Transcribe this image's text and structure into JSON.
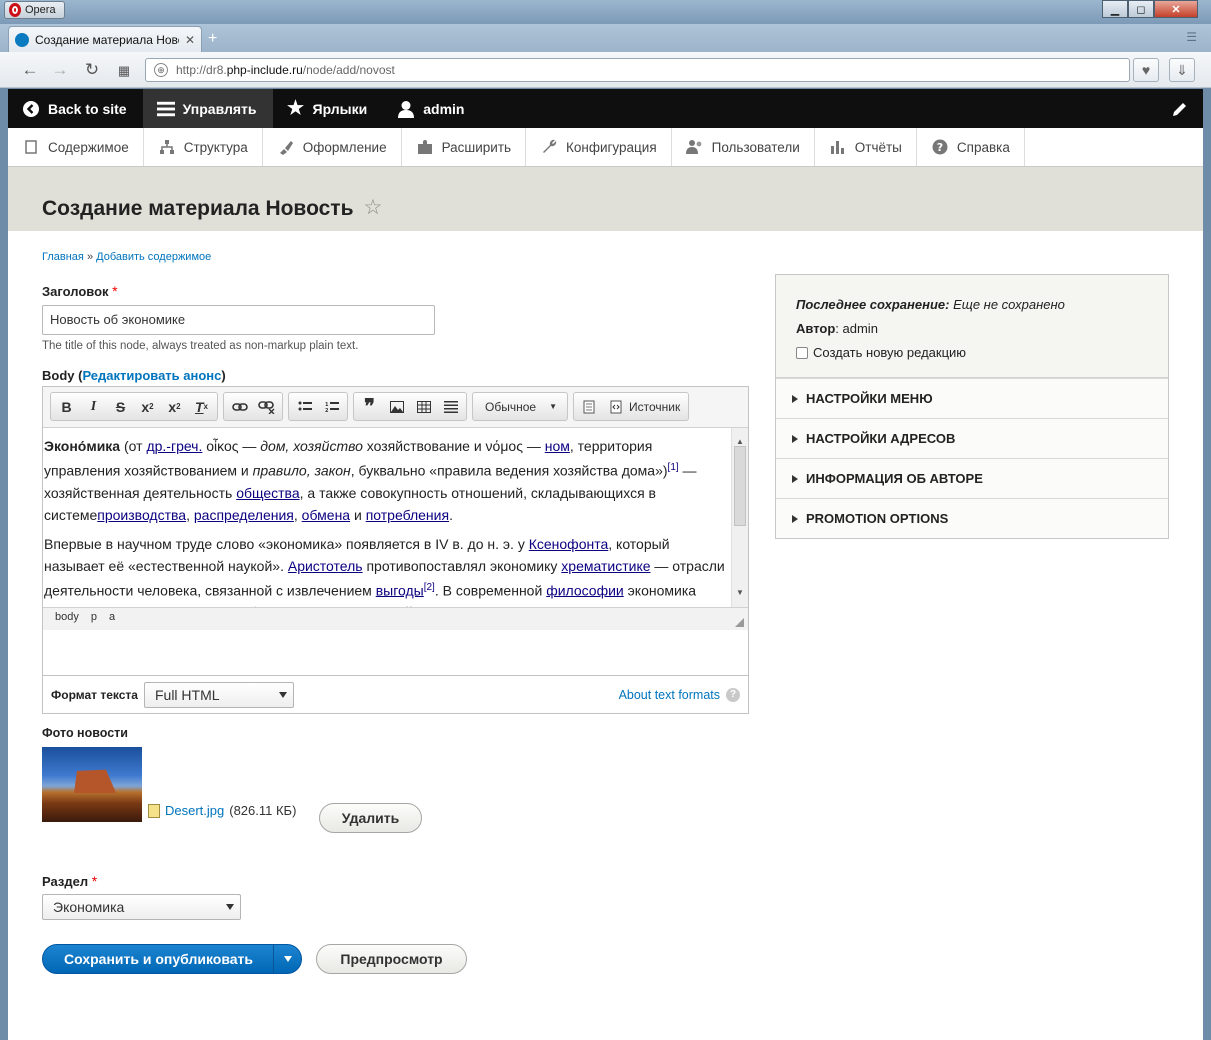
{
  "browser": {
    "app_name": "Opera",
    "tab_title": "Создание материала Новость",
    "url_prefix": "http://dr8.",
    "url_domain": "php-include.ru",
    "url_path": "/node/add/novost",
    "win_minimize": "▁",
    "win_restore": "◻",
    "win_close": "✕"
  },
  "toolbar": {
    "back": "Back to site",
    "manage": "Управлять",
    "shortcuts": "Ярлыки",
    "user": "admin"
  },
  "tray": {
    "items": [
      "Содержимое",
      "Структура",
      "Оформление",
      "Расширить",
      "Конфигурация",
      "Пользователи",
      "Отчёты",
      "Справка"
    ]
  },
  "page": {
    "title": "Создание материала Новость",
    "breadcrumb": [
      "Главная",
      "Добавить содержимое"
    ],
    "breadcrumb_sep": "»"
  },
  "form": {
    "title_label": "Заголовок",
    "title_value": "Новость об экономике",
    "title_desc": "The title of this node, always treated as non-markup plain text.",
    "body_label": "Body (",
    "body_link": "Редактировать анонс",
    "body_label_end": ")",
    "editor": {
      "format_combo": "Обычное",
      "source": "Источник",
      "path": [
        "body",
        "p",
        "a"
      ]
    },
    "format_label": "Формат текста",
    "format_value": "Full HTML",
    "about_formats": "About text formats",
    "photo_label": "Фото новости",
    "file_name": "Desert.jpg",
    "file_size": "(826.11 КБ)",
    "delete_button": "Удалить",
    "section_label": "Раздел",
    "section_value": "Экономика",
    "save_button": "Сохранить и опубликовать",
    "preview_button": "Предпросмотр",
    "required_mark": "*"
  },
  "sidebar": {
    "last_saved_label": "Последнее сохранение:",
    "last_saved_value": "Еще не сохранено",
    "author_label": "Автор",
    "author_value": ": admin",
    "new_revision": "Создать новую редакцию",
    "sections": [
      "НАСТРОЙКИ МЕНЮ",
      "НАСТРОЙКИ АДРЕСОВ",
      "ИНФОРМАЦИЯ ОБ АВТОРЕ",
      "PROMOTION OPTIONS"
    ]
  }
}
